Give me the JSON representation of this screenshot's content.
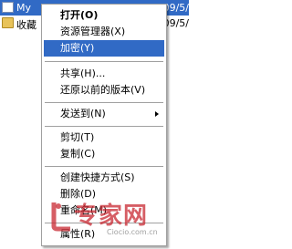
{
  "background": {
    "rows": [
      {
        "name": "My",
        "date": "09/5/"
      },
      {
        "name": "收藏",
        "date": "09/5/"
      }
    ]
  },
  "menu": {
    "items": [
      {
        "label": "打开(O)",
        "bold": true
      },
      {
        "label": "资源管理器(X)"
      },
      {
        "label": "加密(Y)",
        "highlighted": true
      },
      {
        "label": "共享(H)..."
      },
      {
        "label": "还原以前的版本(V)"
      },
      {
        "label": "发送到(N)",
        "submenu": true
      },
      {
        "label": "剪切(T)"
      },
      {
        "label": "复制(C)"
      },
      {
        "label": "创建快捷方式(S)"
      },
      {
        "label": "删除(D)"
      },
      {
        "label": "重命名(M)"
      },
      {
        "label": "属性(R)"
      }
    ]
  },
  "watermark": {
    "text": "专家网",
    "url": "Ciocio.com.cn"
  },
  "colors": {
    "highlight": "#316ac5",
    "watermark": "#c82832"
  }
}
